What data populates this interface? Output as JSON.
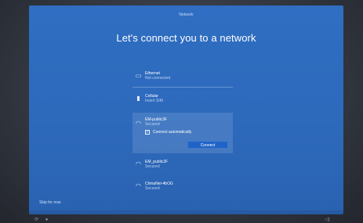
{
  "window": {
    "title": "Network"
  },
  "page": {
    "heading": "Let's connect you to a network"
  },
  "networks": [
    {
      "name": "Ethernet",
      "status": "Not connected",
      "icon": "ethernet-icon",
      "glyph": "▭"
    },
    {
      "name": "Cellular",
      "status": "Insert SIM",
      "icon": "cellular-icon",
      "glyph": "▮"
    },
    {
      "name": "EM-public3F",
      "status": "Secured",
      "icon": "wifi-secured-icon",
      "glyph": "◠"
    },
    {
      "name": "EM_public2F",
      "status": "Secured",
      "icon": "wifi-secured-icon",
      "glyph": "◠"
    },
    {
      "name": "ChinaNet-4bOG",
      "status": "Secured",
      "icon": "wifi-secured-icon",
      "glyph": "◠"
    }
  ],
  "selected_network": {
    "connect_automatically_label": "Connect automatically",
    "connect_automatically_checked": true,
    "check_glyph": "✓",
    "connect_button": "Connect"
  },
  "footer": {
    "skip_label": "Skip for now",
    "icons": [
      "accessibility-icon",
      "microphone-icon",
      "volume-icon"
    ]
  },
  "colors": {
    "background_blue": "#2f6ec2",
    "button_blue": "#1f63c6",
    "text_white": "#ffffff",
    "subtext": "#bcd2f2"
  }
}
